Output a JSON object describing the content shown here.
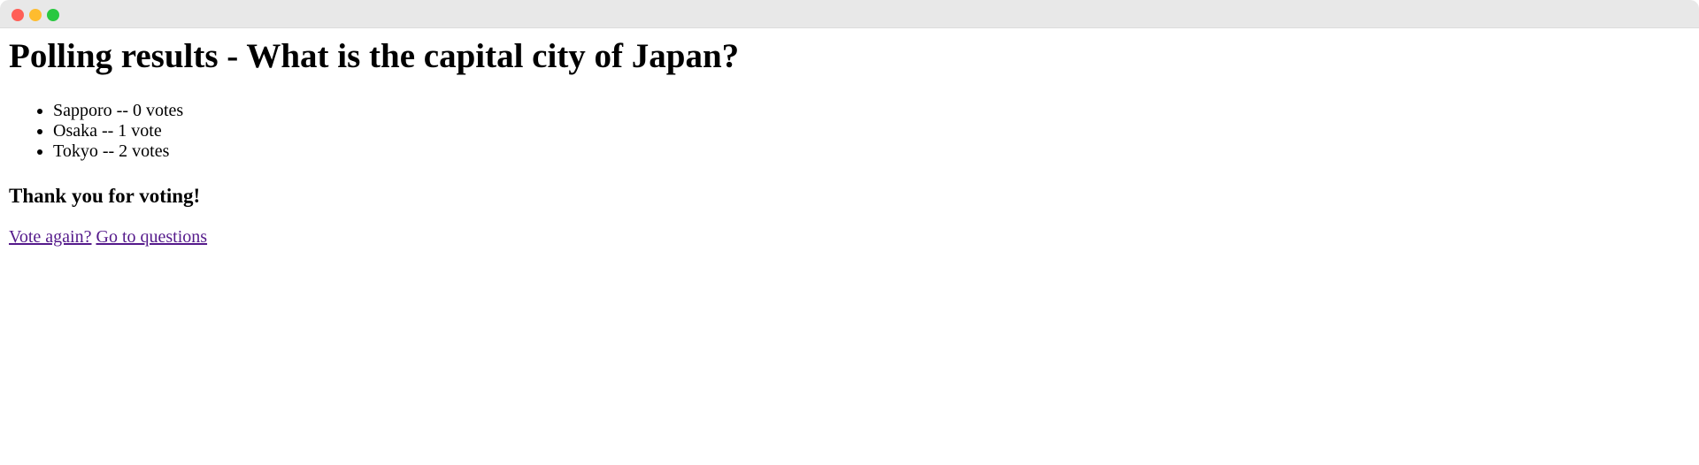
{
  "page": {
    "title": "Polling results - What is the capital city of Japan?"
  },
  "results": [
    {
      "text": "Sapporo -- 0 votes"
    },
    {
      "text": "Osaka -- 1 vote"
    },
    {
      "text": "Tokyo -- 2 votes"
    }
  ],
  "thank_you": "Thank you for voting!",
  "links": {
    "vote_again": "Vote again?",
    "go_to_questions": "Go to questions"
  },
  "colors": {
    "visited_link": "#551a8b",
    "close": "#ff5f57",
    "minimize": "#febc2e",
    "maximize": "#28c840"
  }
}
